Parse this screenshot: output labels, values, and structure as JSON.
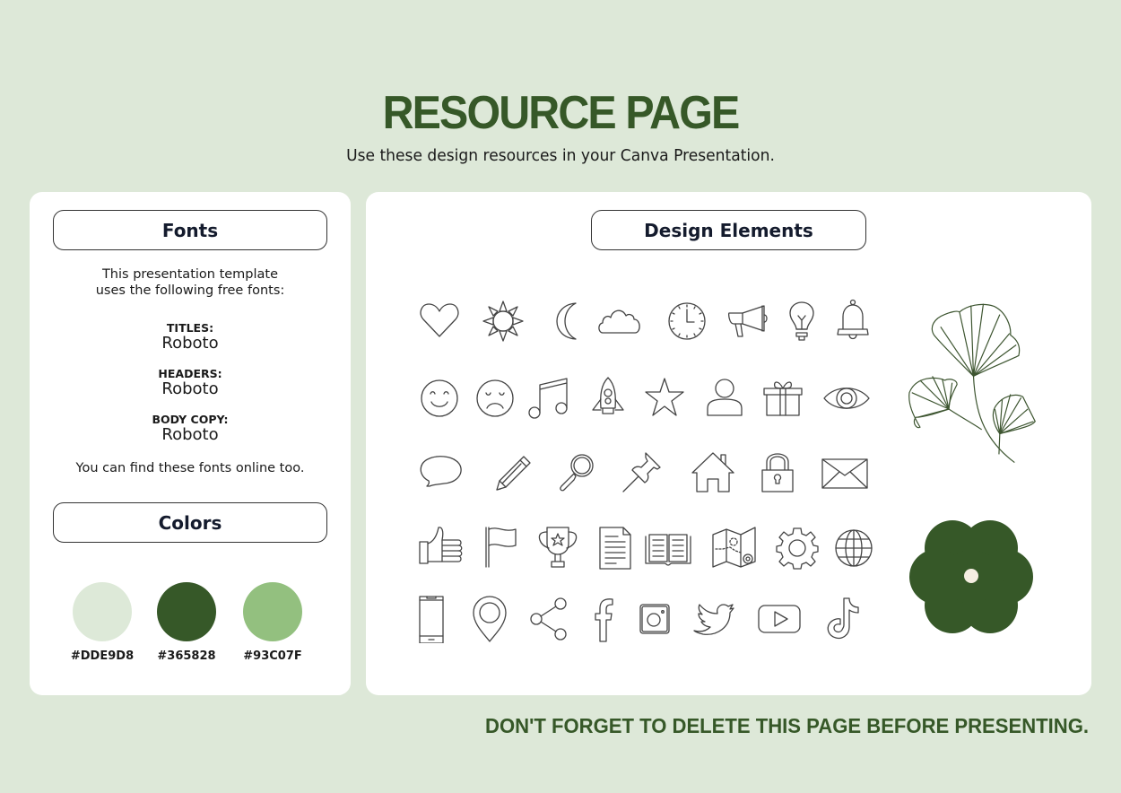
{
  "header": {
    "title": "RESOURCE PAGE",
    "subtitle": "Use these design resources in your Canva Presentation."
  },
  "fonts_panel": {
    "heading": "Fonts",
    "intro_line1": "This presentation template",
    "intro_line2": "uses the following free fonts:",
    "entries": [
      {
        "label": "TITLES:",
        "font": "Roboto"
      },
      {
        "label": "HEADERS:",
        "font": "Roboto"
      },
      {
        "label": "BODY COPY:",
        "font": "Roboto"
      }
    ],
    "note": "You can find these fonts online too."
  },
  "colors_panel": {
    "heading": "Colors",
    "swatches": [
      {
        "hex": "#DDE9D8",
        "color": "#dde9d8"
      },
      {
        "hex": "#365828",
        "color": "#365828"
      },
      {
        "hex": "#93C07F",
        "color": "#93c07f"
      }
    ]
  },
  "design_panel": {
    "heading": "Design Elements",
    "icons": [
      [
        "heart-icon",
        "sun-icon",
        "moon-icon",
        "cloud-icon",
        "clock-icon",
        "megaphone-icon",
        "lightbulb-icon",
        "bell-icon"
      ],
      [
        "smiley-icon",
        "sad-face-icon",
        "music-note-icon",
        "rocket-icon",
        "star-icon",
        "user-icon",
        "gift-icon",
        "eye-icon"
      ],
      [
        "speech-bubble-icon",
        "pencil-icon",
        "magnifier-icon",
        "pushpin-icon",
        "house-icon",
        "padlock-icon",
        "envelope-icon"
      ],
      [
        "thumbs-up-icon",
        "flag-icon",
        "trophy-icon",
        "document-icon",
        "open-book-icon",
        "map-icon",
        "gear-icon",
        "globe-icon"
      ],
      [
        "smartphone-icon",
        "location-pin-icon",
        "share-icon",
        "facebook-icon",
        "instagram-icon",
        "twitter-icon",
        "youtube-icon",
        "tiktok-icon"
      ]
    ],
    "illustrations": [
      "ginkgo-leaves-illustration",
      "flower-shape"
    ],
    "flower_color": "#365828",
    "flower_center_color": "#f5eee2"
  },
  "footer": {
    "reminder": "DON'T FORGET TO DELETE THIS PAGE BEFORE PRESENTING."
  }
}
